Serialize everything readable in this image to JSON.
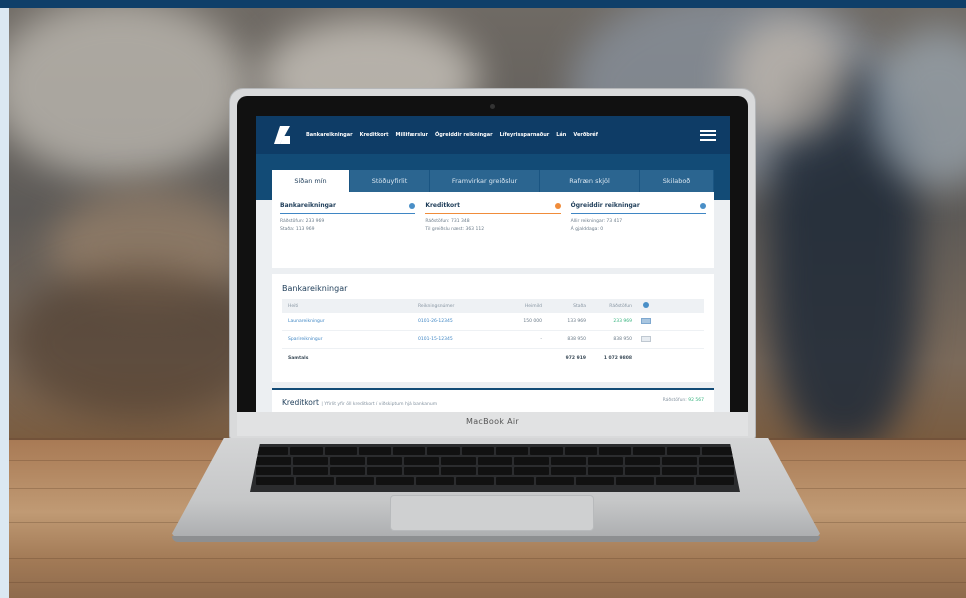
{
  "laptop": {
    "brand": "MacBook Air"
  },
  "nav": {
    "items": [
      "Bankareikningar",
      "Kreditkort",
      "Millifærslur",
      "Ógreiddir reikningar",
      "Lífeyrissparnaður",
      "Lán",
      "Verðbréf"
    ]
  },
  "tabs": [
    {
      "label": "Síðan mín",
      "active": true
    },
    {
      "label": "Stöðuyfirlit"
    },
    {
      "label": "Framvirkar greiðslur"
    },
    {
      "label": "Rafræn skjöl"
    },
    {
      "label": "Skilaboð"
    }
  ],
  "summary": {
    "cards": [
      {
        "title": "Bankareikningar",
        "lines": [
          "Ráðstöfun: 233 969",
          "Staða: 113 969"
        ]
      },
      {
        "title": "Kreditkort",
        "lines": [
          "Ráðstöfun: 731 348",
          "Til greiðslu næst: 363 112"
        ]
      },
      {
        "title": "Ógreiddir reikningar",
        "lines": [
          "Allir reikningar: 73 417",
          "Á gjalddaga: 0"
        ]
      }
    ]
  },
  "accounts": {
    "title": "Bankareikningar",
    "columns": [
      "Heiti",
      "Reikningsnúmer",
      "Heimild",
      "Staða",
      "Ráðstöfun"
    ],
    "rows": [
      {
        "name": "Launareikningur",
        "number": "0101-26-12345",
        "limit": "150 000",
        "balance": "133 969",
        "available": "233 969"
      },
      {
        "name": "Sparireikningur",
        "number": "0101-15-12345",
        "limit": "-",
        "balance": "838 950",
        "available": "838 950"
      }
    ],
    "total": {
      "label": "Samtals",
      "balance": "972 919",
      "available": "1 072 9808"
    }
  },
  "credit": {
    "title": "Kreditkort",
    "subtitle": "Yfirlit yfir öll kreditkort í viðskiptum hjá bankanum",
    "right_label": "Ráðstöfun:",
    "right_value": "92 567"
  },
  "colors": {
    "nav": "#0e3c66",
    "accent_blue": "#3f86c4",
    "accent_orange": "#f08c3a",
    "positive": "#36b37e"
  }
}
